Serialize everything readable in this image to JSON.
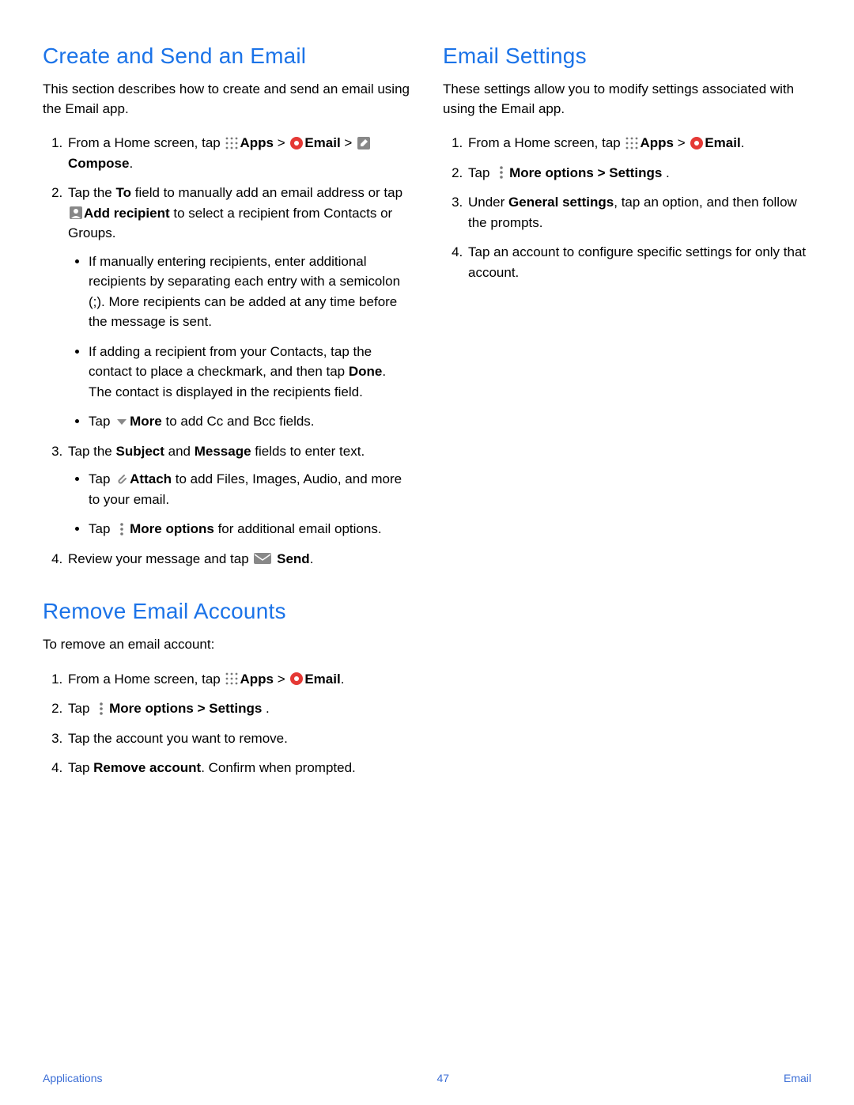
{
  "left": {
    "h1": "Create and Send an Email",
    "intro": "This section describes how to create and send an email using the Email app.",
    "s1_a": "From a Home screen, tap ",
    "s1_apps": "Apps",
    "s1_gt": " > ",
    "s1_email": "Email",
    "s1_gt2": " > ",
    "s1_compose": "Compose",
    "s1_end": ".",
    "s2_a": "Tap the ",
    "s2_to": "To",
    "s2_b": " field to manually add an email address or tap ",
    "s2_addrec": "Add recipient",
    "s2_c": " to select a recipient from Contacts or Groups.",
    "s2_bullet1": "If manually entering recipients, enter additional recipients by separating each entry with a semicolon (;). More recipients can be added at any time before the message is sent.",
    "s2_bullet2_a": "If adding a recipient from your Contacts, tap the contact to place a checkmark, and then tap ",
    "s2_bullet2_done": "Done",
    "s2_bullet2_b": ". The contact is displayed in the recipients field.",
    "s2_bullet3_a": "Tap ",
    "s2_bullet3_more": "More",
    "s2_bullet3_b": " to add Cc and Bcc fields.",
    "s3_a": "Tap the ",
    "s3_subject": "Subject",
    "s3_and": " and ",
    "s3_message": "Message",
    "s3_b": " fields to enter text.",
    "s3_bullet1_a": "Tap ",
    "s3_bullet1_attach": "Attach",
    "s3_bullet1_b": " to add Files, Images, Audio, and more to your email.",
    "s3_bullet2_a": "Tap ",
    "s3_bullet2_more": "More options",
    "s3_bullet2_b": " for additional email options.",
    "s4_a": "Review your message and tap ",
    "s4_send": " Send",
    "s4_b": ".",
    "h2": "Remove Email Accounts",
    "r_intro": "To remove an email account:",
    "r1_a": "From a Home screen, tap ",
    "r1_apps": "Apps",
    "r1_gt": " >  ",
    "r1_email": "Email",
    "r1_b": ".",
    "r2_a": "Tap ",
    "r2_more": "More options > Settings",
    "r2_b": " .",
    "r3": "Tap the account you want to remove.",
    "r4_a": "Tap ",
    "r4_rem": "Remove account",
    "r4_b": ". Confirm when prompted."
  },
  "right": {
    "h1": "Email Settings",
    "intro": "These settings allow you to modify settings associated with using the Email app.",
    "s1_a": "From a Home screen, tap ",
    "s1_apps": "Apps",
    "s1_gt": " > ",
    "s1_email": "Email",
    "s1_b": ".",
    "s2_a": "Tap ",
    "s2_more": "More options > Settings",
    "s2_b": " .",
    "s3_a": "Under ",
    "s3_gen": "General settings",
    "s3_b": ", tap an option, and then follow the prompts.",
    "s4": "Tap an account to configure specific settings for only that account."
  },
  "footer": {
    "left": "Applications",
    "page": "47",
    "right": "Email"
  }
}
